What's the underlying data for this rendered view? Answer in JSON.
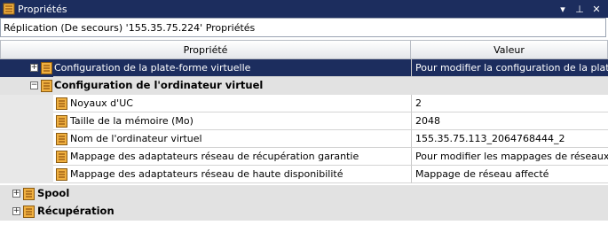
{
  "window": {
    "title": "Propriétés",
    "pin_glyph": "▾",
    "autohide_glyph": "⊥",
    "close_glyph": "✕"
  },
  "breadcrumb": "Réplication (De secours) '155.35.75.224' Propriétés",
  "columns": {
    "property": "Propriété",
    "value": "Valeur"
  },
  "rows": [
    {
      "label": "Configuration de la plate-forme virtuelle",
      "value": "Pour modifier la configuration de la plate"
    },
    {
      "label": "Configuration de l'ordinateur virtuel"
    },
    {
      "label": "Noyaux d'UC",
      "value": "2"
    },
    {
      "label": "Taille de la mémoire (Mo)",
      "value": "2048"
    },
    {
      "label": "Nom de l'ordinateur virtuel",
      "value": "155.35.75.113_2064768444_2"
    },
    {
      "label": "Mappage des adaptateurs réseau de récupération garantie",
      "value": "Pour modifier les mappages de réseaux"
    },
    {
      "label": "Mappage des adaptateurs réseau de haute disponibilité",
      "value": "Mappage de réseau affecté"
    },
    {
      "label": "Spool"
    },
    {
      "label": "Récupération"
    }
  ],
  "expander_glyphs": {
    "collapsed": "+",
    "expanded": "−"
  }
}
